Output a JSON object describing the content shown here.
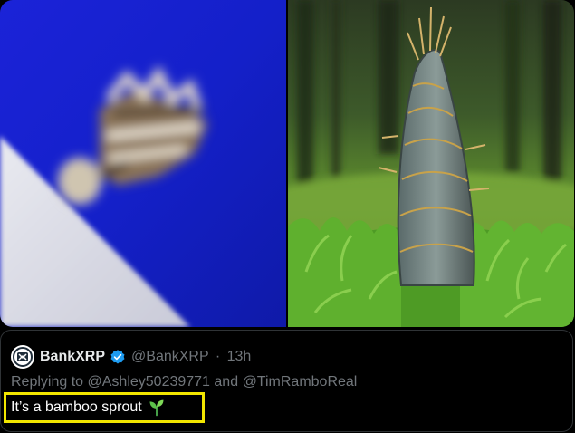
{
  "tweet": {
    "display_name": "BankXRP",
    "verified": true,
    "handle": "@BankXRP",
    "separator": "·",
    "time": "13h",
    "reply": {
      "prefix": "Replying to",
      "user1": "@Ashley50239771",
      "conjunction": "and",
      "user2": "@TimRamboReal"
    },
    "text": "It’s a bamboo sprout",
    "emoji_icon": "seedling-icon"
  },
  "media": {
    "left_image": "blurry-close-up-on-blue-background",
    "right_image": "bamboo-shoot-in-grass"
  },
  "colors": {
    "background": "#000000",
    "name": "#e7e9ea",
    "muted": "#71767b",
    "verified_badge": "#1d9bf0",
    "highlight_border": "#f2e600",
    "sprout_green": "#4caf50"
  },
  "icons": [
    "bankxrp-avatar-icon",
    "verified-badge-icon",
    "seedling-icon"
  ]
}
